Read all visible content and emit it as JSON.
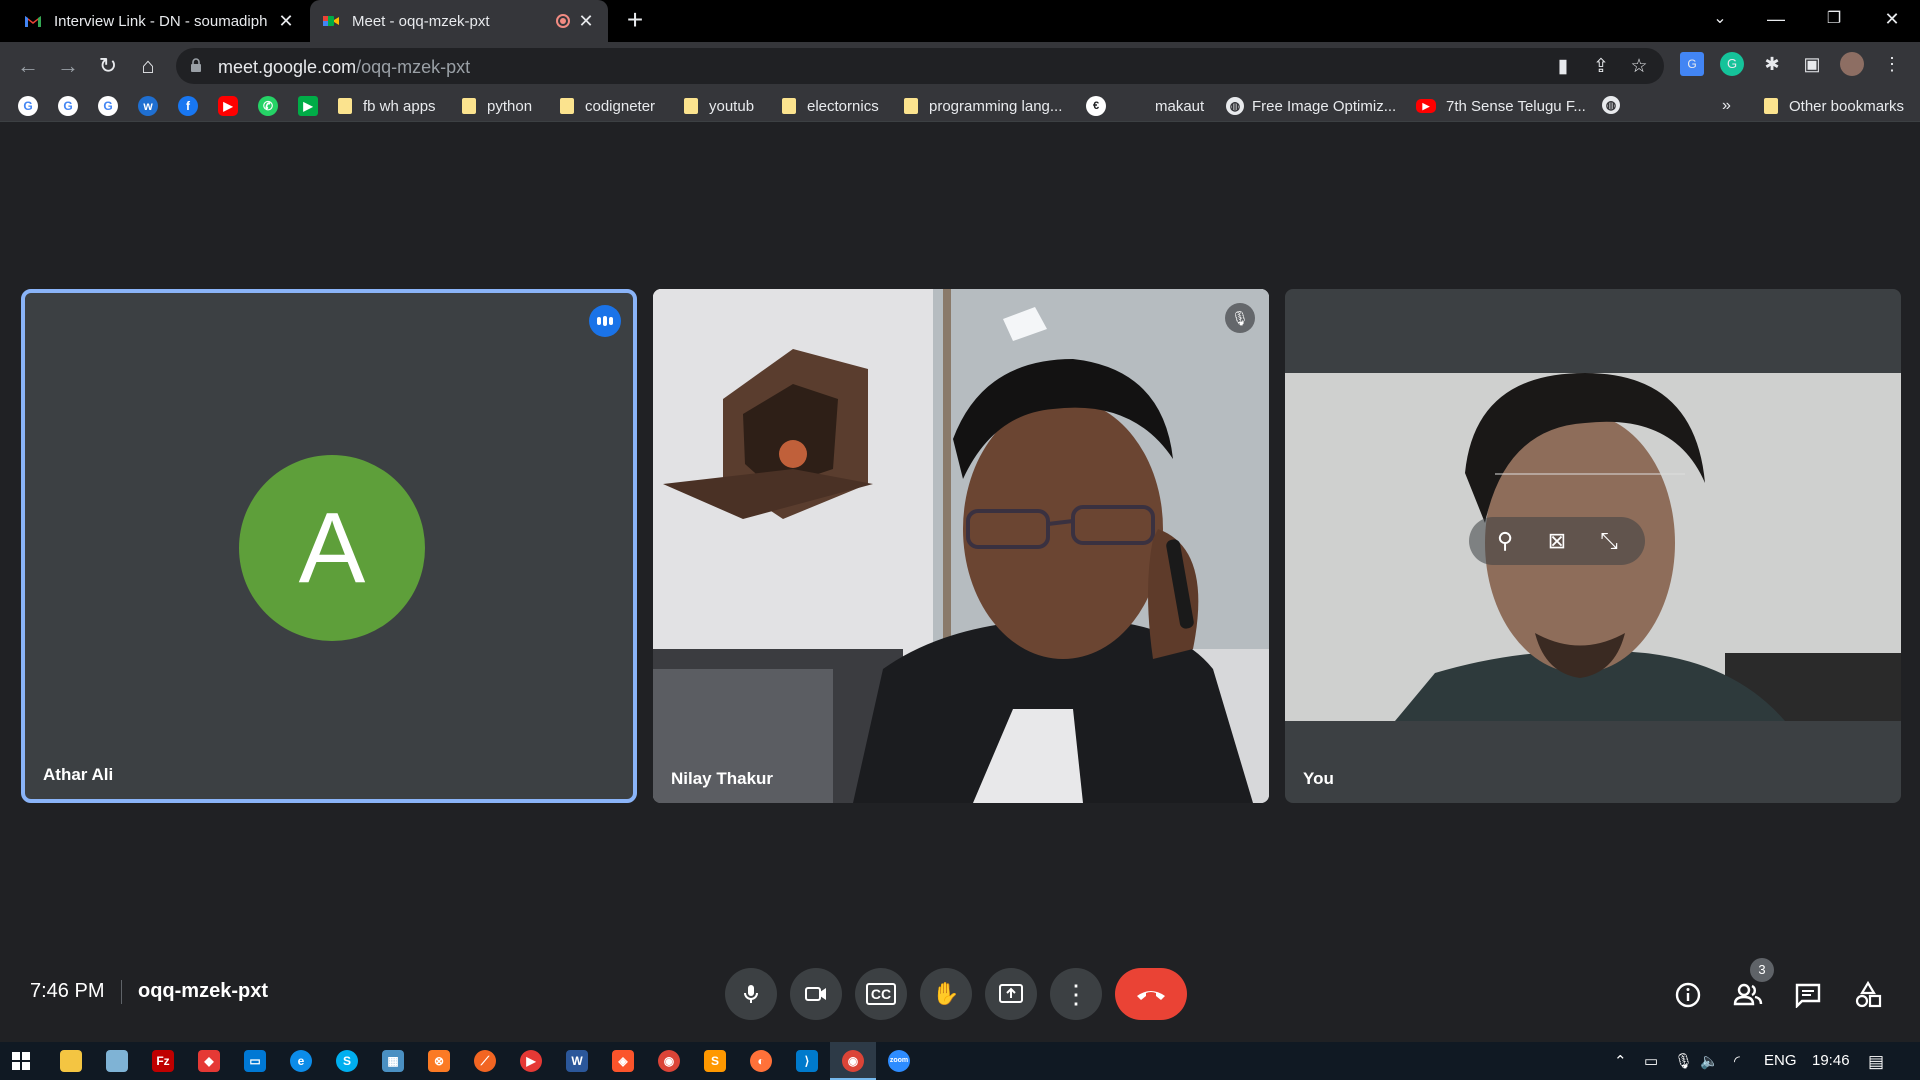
{
  "browser": {
    "tabs": [
      {
        "title": "Interview Link - DN - soumadiph",
        "favicon": "gmail-icon"
      },
      {
        "title": "Meet - oqq-mzek-pxt",
        "favicon": "meet-icon",
        "recording": true
      }
    ],
    "url_host": "meet.google.com",
    "url_path": "/oqq-mzek-pxt",
    "bookmarks": [
      {
        "label": "fb wh apps",
        "icon": "folder-icon"
      },
      {
        "label": "python",
        "icon": "folder-icon"
      },
      {
        "label": "codigneter",
        "icon": "folder-icon"
      },
      {
        "label": "youtub",
        "icon": "folder-icon"
      },
      {
        "label": "electornics",
        "icon": "folder-icon"
      },
      {
        "label": "programming lang...",
        "icon": "folder-icon"
      },
      {
        "label": "makaut",
        "icon": "site-icon"
      },
      {
        "label": "Free Image Optimiz...",
        "icon": "globe-icon"
      },
      {
        "label": "7th Sense Telugu F...",
        "icon": "youtube-icon"
      }
    ],
    "bookmarks_overflow": "»",
    "other_bookmarks": "Other bookmarks"
  },
  "meet": {
    "participants": [
      {
        "name": "Athar Ali",
        "initial": "A",
        "avatar_color": "#5e9f3a",
        "speaking": true
      },
      {
        "name": "Nilay Thakur",
        "muted": true
      },
      {
        "name": "You"
      }
    ],
    "time": "7:46 PM",
    "meeting_code": "oqq-mzek-pxt",
    "people_count": "3",
    "accent": "#8ab4f8",
    "end_call_color": "#ea4335"
  },
  "taskbar": {
    "language": "ENG",
    "clock": "19:46"
  }
}
